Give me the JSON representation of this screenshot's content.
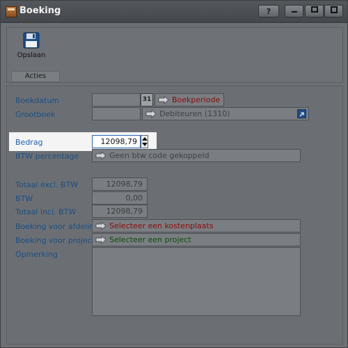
{
  "window": {
    "title": "Boeking",
    "help_label": "?"
  },
  "ribbon": {
    "save_label": "Opslaan",
    "group_label": "Acties"
  },
  "form": {
    "boekdatum": {
      "label": "Boekdatum",
      "value": "",
      "calendar_label": "31",
      "period_link": "Boekperiode"
    },
    "grootboek": {
      "label": "Grootboek",
      "value": "",
      "link_text": "Debiteuren (1310)"
    },
    "bedrag": {
      "label": "Bedrag",
      "value": "12098,79"
    },
    "btw_percentage": {
      "label": "BTW percentage",
      "link_text": "Geen btw code gekoppeld"
    },
    "totaal_excl": {
      "label": "Totaal excl. BTW",
      "value": "12098,79"
    },
    "btw": {
      "label": "BTW",
      "value": "0,00"
    },
    "totaal_incl": {
      "label": "Totaal incl. BTW",
      "value": "12098,79"
    },
    "afdeling": {
      "label": "Boeking voor afdeling",
      "link_text": "Selecteer een kostenplaats"
    },
    "project": {
      "label": "Boeking voor project",
      "link_text": "Selecteer een project"
    },
    "opmerking": {
      "label": "Opmerking",
      "value": ""
    }
  },
  "colors": {
    "title_bar": "#44474b",
    "label_blue": "#1b4f85",
    "link_red": "#8b0c0c",
    "link_green": "#0d4d0d",
    "link_grey": "#3e4246"
  }
}
